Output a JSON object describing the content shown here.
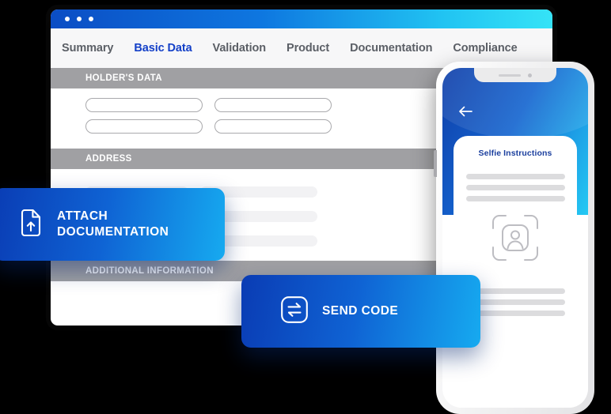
{
  "window": {
    "dots_count": 3,
    "tabs": [
      {
        "label": "Summary",
        "active": false
      },
      {
        "label": "Basic Data",
        "active": true
      },
      {
        "label": "Validation",
        "active": false
      },
      {
        "label": "Product",
        "active": false
      },
      {
        "label": "Documentation",
        "active": false
      },
      {
        "label": "Compliance",
        "active": false
      }
    ],
    "sections": [
      {
        "title": "HOLDER'S DATA"
      },
      {
        "title": "ADDRESS"
      },
      {
        "title": "ADDITIONAL INFORMATION"
      }
    ],
    "holder_fields": [
      {
        "value": "",
        "placeholder": ""
      },
      {
        "value": "",
        "placeholder": ""
      },
      {
        "value": "",
        "placeholder": ""
      },
      {
        "value": "",
        "placeholder": ""
      }
    ]
  },
  "phone": {
    "back_icon": "back-arrow-icon",
    "card_title": "Selfie Instructions",
    "selfie_icon": "face-scan-icon"
  },
  "buttons": {
    "attach": {
      "line1": "ATTACH",
      "line2": "DOCUMENTATION",
      "icon": "document-upload-icon"
    },
    "send": {
      "label": "SEND CODE",
      "icon": "exchange-arrows-icon"
    }
  },
  "colors": {
    "accent_blue": "#1440c8",
    "gradient_start": "#0a3cb4",
    "gradient_end": "#16aaf0",
    "titlebar_start": "#0b4dc4",
    "titlebar_end": "#35e3f7",
    "section_header_bg": "#a0a0a3",
    "skeleton": "#f2f2f4",
    "phone_title": "#1b3f9e"
  }
}
